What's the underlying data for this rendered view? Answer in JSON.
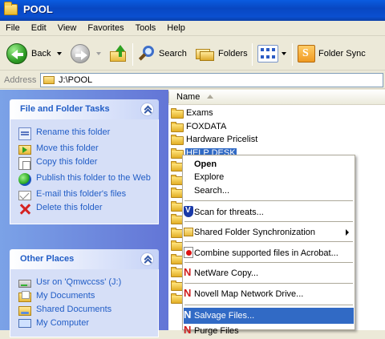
{
  "window": {
    "title": "POOL"
  },
  "menu": [
    "File",
    "Edit",
    "View",
    "Favorites",
    "Tools",
    "Help"
  ],
  "toolbar": {
    "back_label": "Back",
    "search_label": "Search",
    "folders_label": "Folders",
    "folder_sync_label": "Folder Sync"
  },
  "address": {
    "label": "Address",
    "value": "J:\\POOL"
  },
  "tasks_panel": {
    "title": "File and Folder Tasks",
    "items": [
      "Rename this folder",
      "Move this folder",
      "Copy this folder",
      "Publish this folder to the Web",
      "E-mail this folder's files",
      "Delete this folder"
    ]
  },
  "other_places": {
    "title": "Other Places",
    "items": [
      "Usr on 'Qmwccss' (J:)",
      "My Documents",
      "Shared Documents",
      "My Computer"
    ]
  },
  "file_list": {
    "column_name": "Name",
    "folders": [
      "Exams",
      "FOXDATA",
      "Hardware Pricelist",
      "HELP DESK",
      "",
      "",
      "",
      "",
      "",
      "",
      "",
      "",
      "",
      "",
      ""
    ],
    "selected": "HELP DESK"
  },
  "context_menu": {
    "items": [
      "Open",
      "Explore",
      "Search...",
      "Scan for threats...",
      "Shared Folder Synchronization",
      "Combine supported files in Acrobat...",
      "NetWare Copy...",
      "Novell Map Network Drive...",
      "Salvage Files...",
      "Purge Files"
    ],
    "highlighted": "Salvage Files..."
  }
}
